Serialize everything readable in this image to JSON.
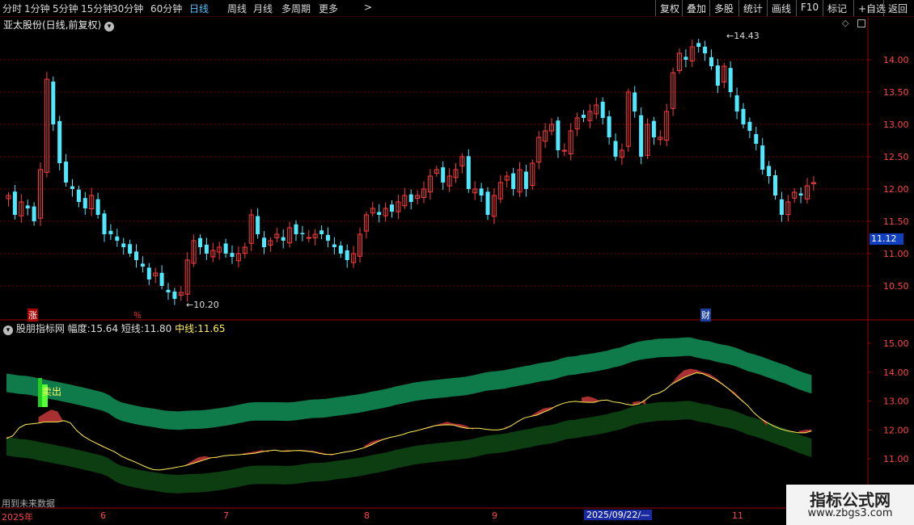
{
  "toolbar": {
    "periods": [
      "分时",
      "1分钟",
      "5分钟",
      "15分钟",
      "30分钟",
      "60分钟",
      "日线",
      "周线",
      "月线",
      "多周期",
      "更多"
    ],
    "active_period": "日线",
    "more_chevron": ">",
    "right_buttons": [
      "复权",
      "叠加",
      "多股",
      "统计",
      "画线",
      "F10",
      "标记",
      "+自选",
      "返回"
    ]
  },
  "main_panel": {
    "title": "亚太股份(日线,前复权)",
    "price_ticks": [
      "14.00",
      "13.50",
      "13.00",
      "12.50",
      "12.00",
      "11.50",
      "11.00",
      "10.50"
    ],
    "current_price": "11.12",
    "high_label": "14.43",
    "low_label": "10.20",
    "markers": [
      "涨",
      "％",
      "财"
    ]
  },
  "indicator_panel": {
    "name": "股朋指标网",
    "amplitude_label": "幅度:",
    "amplitude_value": "15.64",
    "short_label": "短线:",
    "short_value": "11.80",
    "mid_label": "中线:",
    "mid_value": "11.65",
    "ticks": [
      "15.00",
      "14.00",
      "13.00",
      "12.00",
      "11.00"
    ],
    "signal_text": "卖出",
    "warning": "用到未来数据"
  },
  "time_axis": {
    "labels": [
      "2025年",
      "6",
      "7",
      "8",
      "9",
      "2025/09/22/—",
      "11"
    ]
  },
  "watermark": {
    "title": "指标公式网",
    "url": "www.zbgs3.com"
  },
  "colors": {
    "up": "#ff3b3b",
    "down": "#4fe9ff",
    "band": "#0f7a4a",
    "band_dark": "#0d3e12",
    "mid_line": "#ffee55",
    "grid": "#800000"
  },
  "chart_data": {
    "type": "candlestick",
    "price_range": [
      10.2,
      14.43
    ],
    "closes": [
      11.9,
      11.6,
      11.8,
      11.7,
      11.5,
      12.3,
      13.7,
      13.0,
      12.4,
      12.1,
      12.0,
      11.8,
      11.7,
      11.9,
      11.6,
      11.3,
      11.3,
      11.2,
      11.1,
      11.0,
      10.9,
      10.8,
      10.6,
      10.7,
      10.5,
      10.4,
      10.3,
      10.4,
      10.9,
      11.2,
      11.1,
      11.0,
      11.05,
      11.1,
      11.0,
      10.95,
      11.0,
      11.1,
      11.6,
      11.3,
      11.1,
      11.2,
      11.3,
      11.2,
      11.4,
      11.3,
      11.3,
      11.25,
      11.3,
      11.3,
      11.2,
      11.1,
      11.0,
      10.9,
      11.0,
      11.3,
      11.6,
      11.7,
      11.6,
      11.7,
      11.65,
      11.8,
      11.9,
      11.8,
      11.9,
      12.0,
      12.2,
      12.3,
      12.1,
      12.2,
      12.3,
      12.5,
      12.0,
      12.0,
      11.9,
      11.6,
      11.9,
      12.1,
      12.2,
      12.0,
      12.3,
      12.0,
      12.4,
      12.8,
      12.9,
      13.0,
      12.6,
      12.6,
      12.9,
      13.1,
      13.1,
      13.2,
      13.3,
      13.1,
      12.8,
      12.5,
      12.6,
      13.5,
      13.2,
      12.5,
      13.0,
      12.8,
      12.8,
      13.2,
      13.8,
      14.1,
      14.0,
      14.2,
      14.2,
      14.1,
      13.9,
      13.6,
      13.9,
      13.5,
      13.2,
      13.0,
      12.9,
      12.7,
      12.3,
      12.2,
      11.9,
      11.6,
      11.8,
      11.95,
      11.9,
      12.05,
      12.1
    ]
  }
}
